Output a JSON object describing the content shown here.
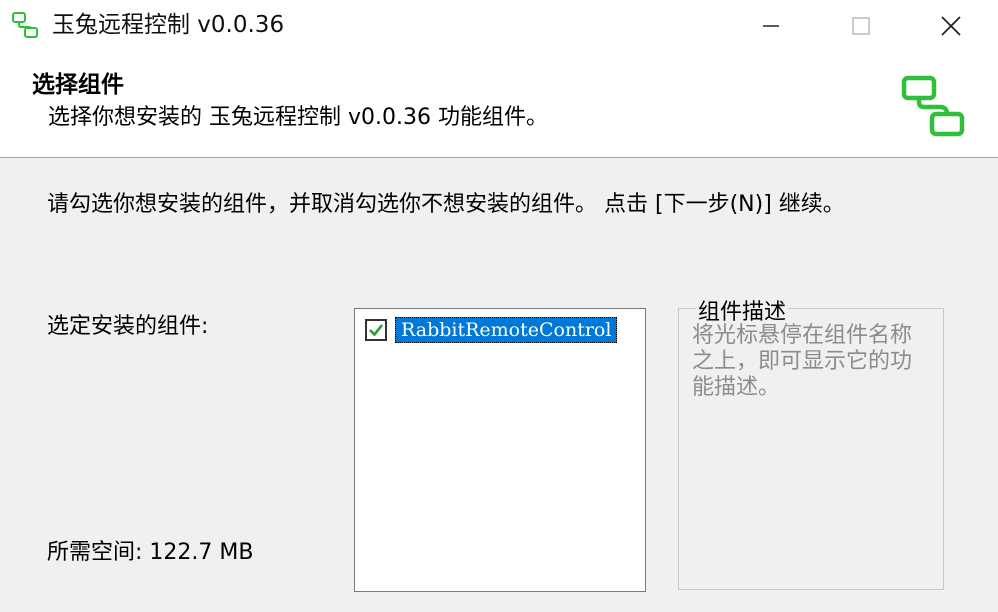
{
  "window": {
    "title": "玉兔远程控制 v0.0.36",
    "icon": "network-computers-icon",
    "controls": [
      "minimize",
      "maximize",
      "close"
    ]
  },
  "header": {
    "title": "选择组件",
    "subtitle": "选择你想安装的 玉兔远程控制 v0.0.36 功能组件。",
    "icon": "network-computers-icon"
  },
  "main": {
    "instruction": "请勾选你想安装的组件，并取消勾选你不想安装的组件。 点击 [下一步(N)] 继续。",
    "select_label": "选定安装的组件:",
    "space_label": "所需空间: 122.7 MB",
    "components": [
      {
        "name": "RabbitRemoteControl",
        "checked": true,
        "selected": true
      }
    ],
    "description": {
      "title": "组件描述",
      "text": "将光标悬停在组件名称之上，即可显示它的功能描述。"
    }
  },
  "colors": {
    "accent_green": "#2fbf3b",
    "selection_blue": "#0078d7",
    "background": "#f0f0f0"
  }
}
